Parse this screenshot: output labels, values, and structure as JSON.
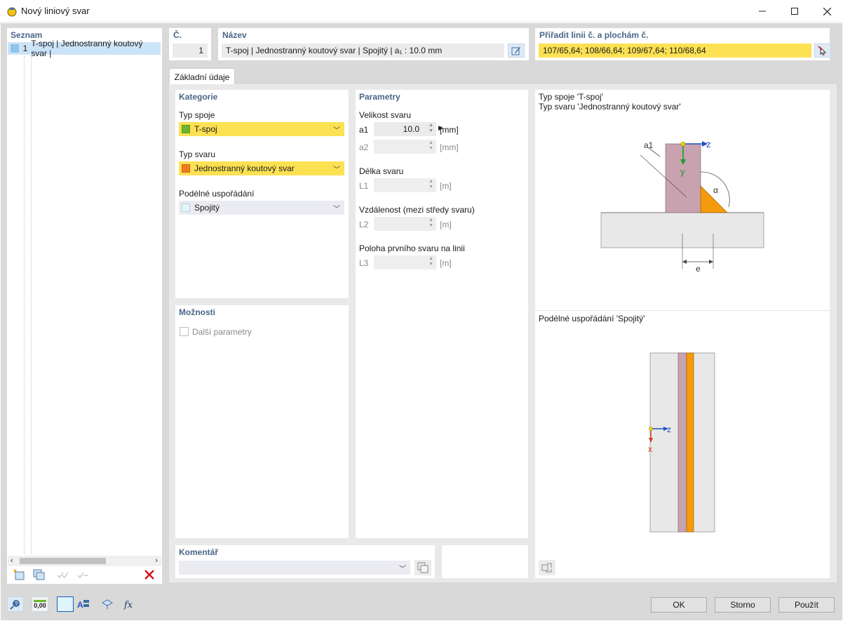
{
  "window": {
    "title": "Nový liniový svar"
  },
  "seznam": {
    "title": "Seznam",
    "items": [
      {
        "number": "1",
        "label": "T-spoj | Jednostranný koutový svar |"
      }
    ]
  },
  "header": {
    "number_label": "Č.",
    "number_value": "1",
    "name_label": "Název",
    "name_value": "T-spoj | Jednostranný koutový svar | Spojitý | a₁ : 10.0 mm",
    "assign_label": "Přiřadit linii č. a plochám č.",
    "assign_value": "107/65,64; 108/66,64; 109/67,64; 110/68,64"
  },
  "tabs": [
    {
      "label": "Základní údaje"
    }
  ],
  "kategorie": {
    "title": "Kategorie",
    "typ_spoje_label": "Typ spoje",
    "typ_spoje_value": "T-spoj",
    "typ_spoje_color": "#6cb52d",
    "typ_svaru_label": "Typ svaru",
    "typ_svaru_value": "Jednostranný koutový svar",
    "typ_svaru_color": "#f07b22",
    "podelne_label": "Podélné uspořádání",
    "podelne_value": "Spojitý",
    "podelne_color": "#e3f6fb"
  },
  "moznosti": {
    "title": "Možnosti",
    "dalsi_parametry": "Další parametry"
  },
  "parametry": {
    "title": "Parametry",
    "velikost_label": "Velikost svaru",
    "a1_label": "a1",
    "a1_value": "10.0",
    "a1_unit": "[mm]",
    "a2_label": "a2",
    "a2_unit": "[mm]",
    "delka_label": "Délka svaru",
    "l1_label": "L1",
    "l1_unit": "[m]",
    "vzdalenost_label": "Vzdálenost (mezi středy svaru)",
    "l2_label": "L2",
    "l2_unit": "[m]",
    "poloha_label": "Poloha prvního svaru na linii",
    "l3_label": "L3",
    "l3_unit": "[m]"
  },
  "preview": {
    "line1": "Typ spoje 'T-spoj'",
    "line2": "Typ svaru 'Jednostranný koutový svar'",
    "podelne_caption": "Podélné uspořádání 'Spojitý'",
    "axis_z": "z",
    "axis_y": "y",
    "axis_x": "x",
    "label_a1": "a1",
    "label_alpha": "α",
    "label_e": "e"
  },
  "komentar": {
    "title": "Komentář"
  },
  "buttons": {
    "ok": "OK",
    "storno": "Storno",
    "pouzit": "Použít"
  },
  "bottom_icons": {
    "value_icon_text": "0,00"
  }
}
